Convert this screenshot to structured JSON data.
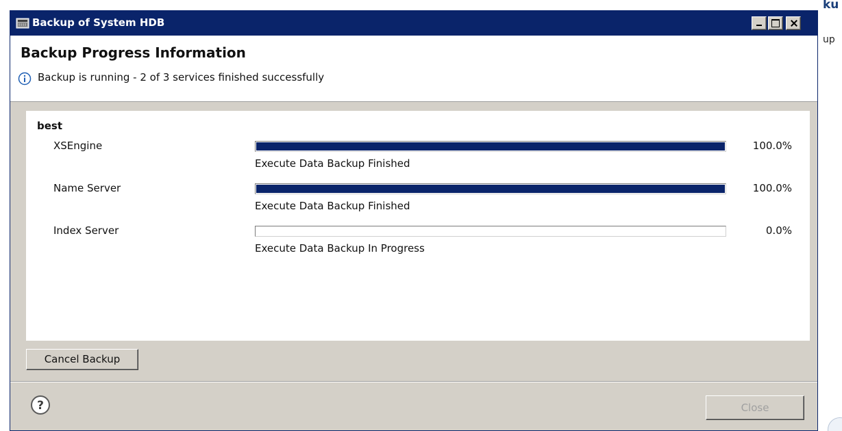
{
  "background": {
    "peek_top_text": "ku",
    "peek_mid_text": "up"
  },
  "window": {
    "title": "Backup of System HDB",
    "icon": "window-app-icon",
    "controls": {
      "minimize": "minimize-icon",
      "maximize": "maximize-icon",
      "close": "close-icon"
    }
  },
  "header": {
    "title": "Backup Progress Information",
    "info_icon": "info-icon",
    "message": "Backup is running - 2 of 3 services finished successfully"
  },
  "group": {
    "title": "best",
    "services": [
      {
        "name": "XSEngine",
        "progress": 1.0,
        "percent_label": "100.0%",
        "status": "Execute Data Backup Finished"
      },
      {
        "name": "Name Server",
        "progress": 1.0,
        "percent_label": "100.0%",
        "status": "Execute Data Backup Finished"
      },
      {
        "name": "Index Server",
        "progress": 0.0,
        "percent_label": "0.0%",
        "status": "Execute Data Backup In Progress"
      }
    ]
  },
  "buttons": {
    "cancel_label": "Cancel Backup",
    "close_label": "Close",
    "help_icon": "help-icon"
  },
  "colors": {
    "title_bar": "#0a246a",
    "progress_fill": "#0a246a",
    "dialog_face": "#d4d0c8",
    "disabled_text": "#a0a0a0"
  }
}
